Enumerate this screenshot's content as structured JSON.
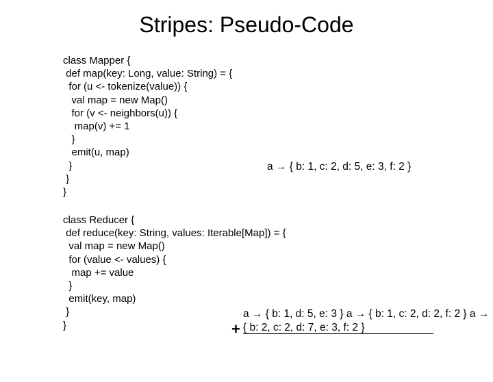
{
  "title": "Stripes: Pseudo-Code",
  "mapper": {
    "line1": "class Mapper {",
    "line2": " def map(key: Long, value: String) = {",
    "line3": "  for (u <- tokenize(value)) {",
    "line4": "   val map = new Map()",
    "line5": "   for (v <- neighbors(u)) {",
    "line6": "    map(v) += 1",
    "line7": "   }",
    "line8": "   emit(u, map)",
    "line9": "  }",
    "line10": " }",
    "line11": "}"
  },
  "mapper_emit": "a → { b: 1, c: 2, d: 5, e: 3, f: 2 }",
  "reducer": {
    "line1": "class Reducer {",
    "line2": " def reduce(key: String, values: Iterable[Map]) = {",
    "line3": "  val map = new Map()",
    "line4": "  for (value <- values) {",
    "line5": "   map += value",
    "line6": "  }",
    "line7": "  emit(key, map)",
    "line8": " }",
    "line9": "}"
  },
  "reducer_emit": {
    "row1": "a → { b: 1,           d: 5, e: 3 }",
    "row2": "a → { b: 1, c: 2, d: 2,           f: 2 }",
    "sum": "a → { b: 2, c: 2, d: 7, e: 3, f: 2 }"
  },
  "plus": "+"
}
